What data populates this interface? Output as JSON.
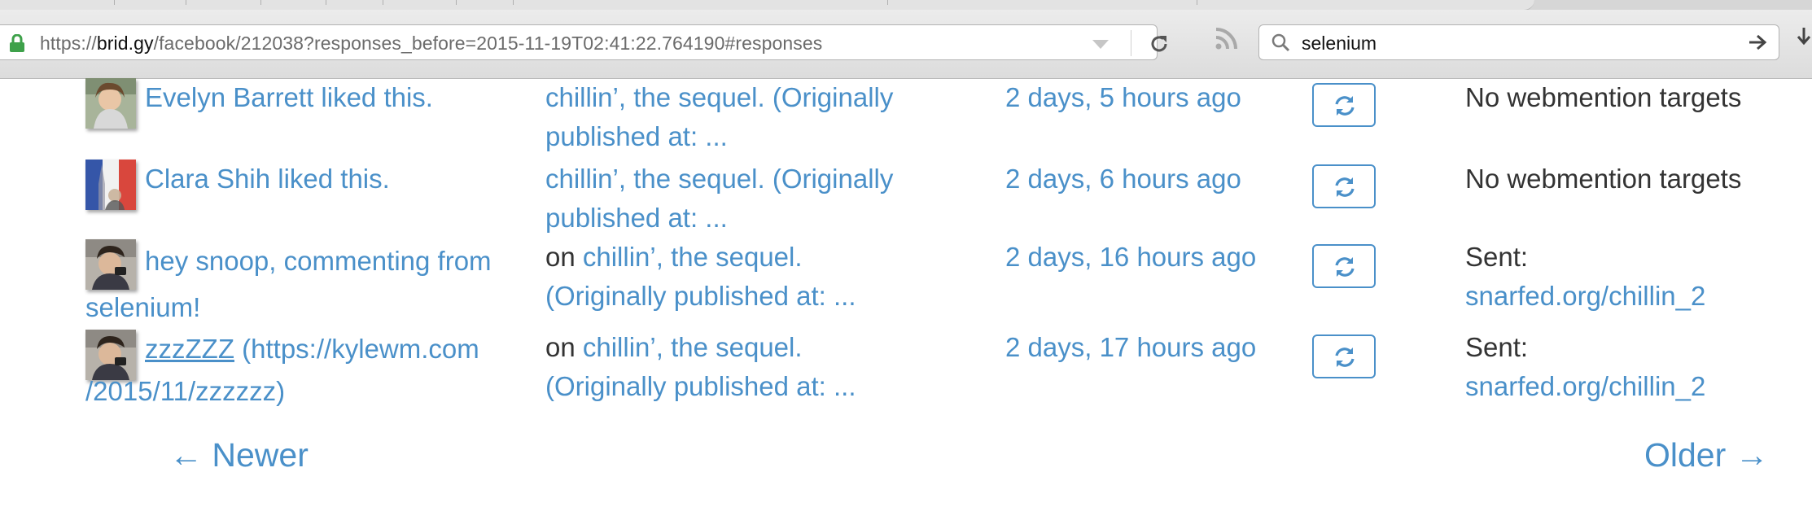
{
  "browser": {
    "url_prefix": "https://",
    "url_domain": "brid.gy",
    "url_rest": "/facebook/212038?responses_before=2015-11-19T02:41:22.764190#responses",
    "search_value": "selenium",
    "icons": [
      "lock-icon",
      "dropdown-arrow-icon",
      "reload-icon",
      "rss-icon",
      "search-icon",
      "go-arrow-icon",
      "download-icon"
    ]
  },
  "responses": [
    {
      "author": "Evelyn Barrett liked this.",
      "author_extra": "",
      "post_prefix": "",
      "post": "chillin’, the sequel. (Originally published at: ...",
      "time": "2 days, 5 hours ago",
      "status_label": "No webmention targets",
      "status_link": ""
    },
    {
      "author": "Clara Shih liked this.",
      "author_extra": "",
      "post_prefix": "",
      "post": "chillin’, the sequel. (Originally published at: ...",
      "time": "2 days, 6 hours ago",
      "status_label": "No webmention targets",
      "status_link": ""
    },
    {
      "author": "hey snoop, commenting from selenium!",
      "author_extra": "",
      "post_prefix": "on ",
      "post": "chillin’, the sequel. (Originally published at: ...",
      "time": "2 days, 16 hours ago",
      "status_label": "Sent:",
      "status_link": "snarfed.org/chillin_2"
    },
    {
      "author": "zzzZZZ",
      "author_extra": " (https://kylewm.com /2015/11/zzzzzz)",
      "post_prefix": "on ",
      "post": "chillin’, the sequel. (Originally published at: ...",
      "time": "2 days, 17 hours ago",
      "status_label": "Sent:",
      "status_link": "snarfed.org/chillin_2"
    }
  ],
  "pager": {
    "newer": "← Newer",
    "older": "Older →"
  },
  "colors": {
    "link": "#4a90c9",
    "text": "#333333",
    "chrome": "#e0e0e0"
  }
}
